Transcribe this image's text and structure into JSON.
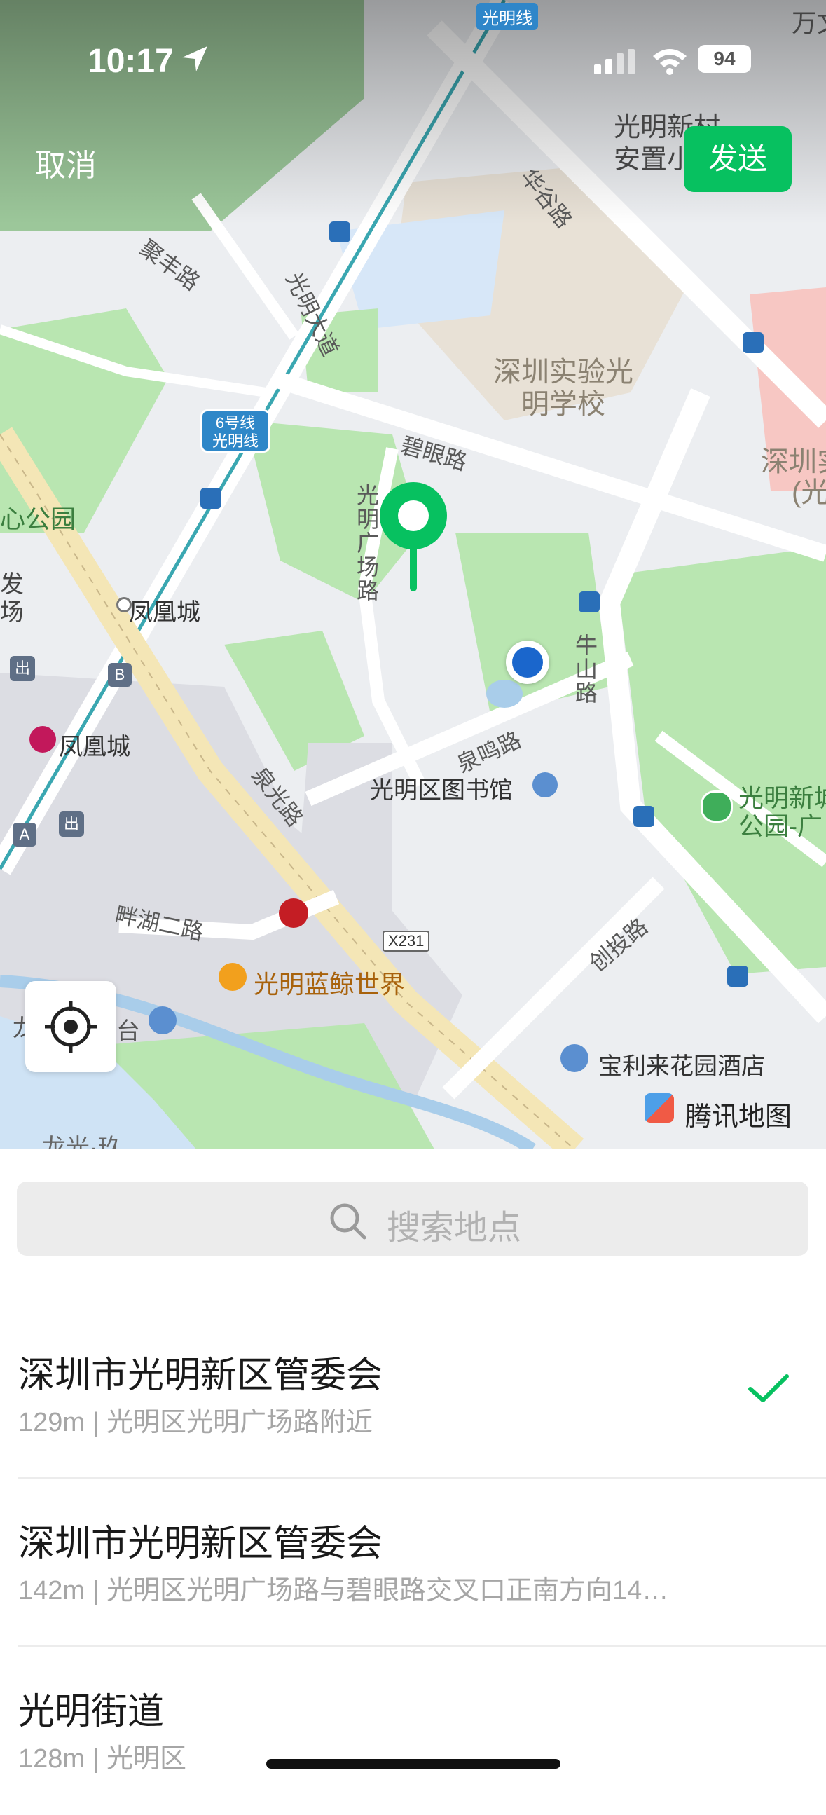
{
  "status_bar": {
    "time": "10:17",
    "battery": "94"
  },
  "header": {
    "cancel_label": "取消",
    "send_label": "发送"
  },
  "map": {
    "labels": {
      "metro_line_top": "光明线",
      "road_jufeng": "聚丰路",
      "road_guangming_avenue": "光明大道",
      "road_huaxia": "华谷路",
      "poi_xincun": "光明新村",
      "poi_anzhi": "安置小",
      "top_right_cut": "万文",
      "school": "深圳实验光明学校",
      "school_right": "深圳实",
      "school_right2": "(光",
      "line6_badge_1": "6号线",
      "line6_badge_2": "光明线",
      "road_biyan": "碧眼路",
      "road_guangchang": "光明广场路",
      "park_left": "心公园",
      "left_cut_1": "发",
      "left_cut_2": "场",
      "fenghuang_city_1": "凤凰城",
      "fenghuang_city_2": "凤凰城",
      "road_niushan": "牛山路",
      "road_quanming": "泉鸣路",
      "library": "光明区图书馆",
      "road_quanguang": "泉光路",
      "park_right_1": "光明新城",
      "park_right_2": "公园-广",
      "road_panhu": "畔湖二路",
      "x231": "X231",
      "road_chuangtou": "创投路",
      "whale_world": "光明蓝鲸世界",
      "hotel": "宝利来花园酒店",
      "bottom_left_1": "龙",
      "bottom_left_2": "台",
      "bottom_cut": "龙光·玖",
      "brand": "腾讯地图",
      "exit_1": "出",
      "exit_2": "出",
      "entrance_a": "A",
      "entrance_b": "B"
    }
  },
  "search": {
    "placeholder": "搜索地点"
  },
  "results": [
    {
      "title": "深圳市光明新区管委会",
      "subtitle": "129m | 光明区光明广场路附近",
      "selected": true
    },
    {
      "title": "深圳市光明新区管委会",
      "subtitle": "142m | 光明区光明广场路与碧眼路交叉口正南方向14…",
      "selected": false
    },
    {
      "title": "光明街道",
      "subtitle": "128m | 光明区",
      "selected": false
    }
  ],
  "colors": {
    "accent": "#07c160",
    "pin": "#07c160",
    "user_dot": "#1a66cc"
  }
}
